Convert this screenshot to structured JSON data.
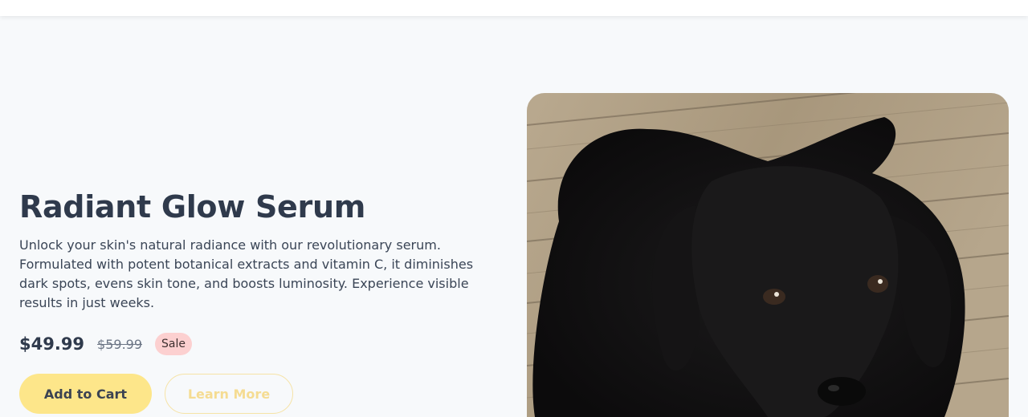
{
  "product": {
    "title": "Radiant Glow Serum",
    "description": "Unlock your skin's natural radiance with our revolutionary serum. Formulated with potent botanical extracts and vitamin C, it diminishes dark spots, evens skin tone, and boosts luminosity. Experience visible results in just weeks.",
    "price": "$49.99",
    "original_price": "$59.99",
    "badge": "Sale"
  },
  "actions": {
    "add_to_cart": "Add to Cart",
    "learn_more": "Learn More"
  },
  "colors": {
    "primary_button": "#fde68a",
    "sale_badge": "#fcd0d0",
    "title_text": "#2f3a4c",
    "background": "#f7f9fb"
  }
}
